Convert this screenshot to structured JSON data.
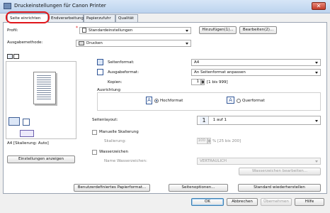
{
  "window": {
    "title": "Druckeinstellungen für Canon Printer",
    "close_symbol": "✕"
  },
  "tabs": [
    {
      "label": "Seite einrichten",
      "active": true
    },
    {
      "label": "Endverarbeitung",
      "active": false
    },
    {
      "label": "Papierzufuhr",
      "active": false
    },
    {
      "label": "Qualität",
      "active": false
    }
  ],
  "profile": {
    "label": "Profil:",
    "value": "Standardeinstellungen",
    "add_button": "Hinzufügen(1)...",
    "edit_button": "Bearbeiten(2)..."
  },
  "output": {
    "label": "Ausgabemethode:",
    "value": "Drucken"
  },
  "preview": {
    "caption": "A4 [Skalierung: Auto]",
    "settings_button": "Einstellungen anzeigen"
  },
  "page_size": {
    "label": "Seitenformat:",
    "value": "A4"
  },
  "output_size": {
    "label": "Ausgabeformat:",
    "value": "An Seitenformat anpassen"
  },
  "copies": {
    "label": "Kopien:",
    "value": "1",
    "range": "[1 bis 999]"
  },
  "orientation": {
    "label": "Ausrichtung",
    "portrait": "Hochformat",
    "landscape": "Querformat",
    "selected": "portrait"
  },
  "layout": {
    "label": "Seitenlayout:",
    "number": "1",
    "value": "1 auf 1"
  },
  "scaling": {
    "label": "Manuelle Skalierung",
    "scale_label": "Skalierung:",
    "value": "100",
    "range": "% [25 bis 200]"
  },
  "watermark": {
    "label": "Wasserzeichen",
    "name_label": "Name Wasserzeichen:",
    "value": "VERTRAULICH",
    "edit_button": "Wasserzeichen bearbeiten..."
  },
  "bottom_buttons": {
    "custom_paper": "Benutzerdefiniertes Papierformat...",
    "page_options": "Seitenoptionen...",
    "restore_defaults": "Standard wiederherstellen"
  },
  "dialog_buttons": {
    "ok": "OK",
    "cancel": "Abbrechen",
    "apply": "Übernehmen",
    "help": "Hilfe"
  },
  "colors": {
    "highlight_ring": "#e0161b",
    "title_bar": "#bcd3ee"
  }
}
